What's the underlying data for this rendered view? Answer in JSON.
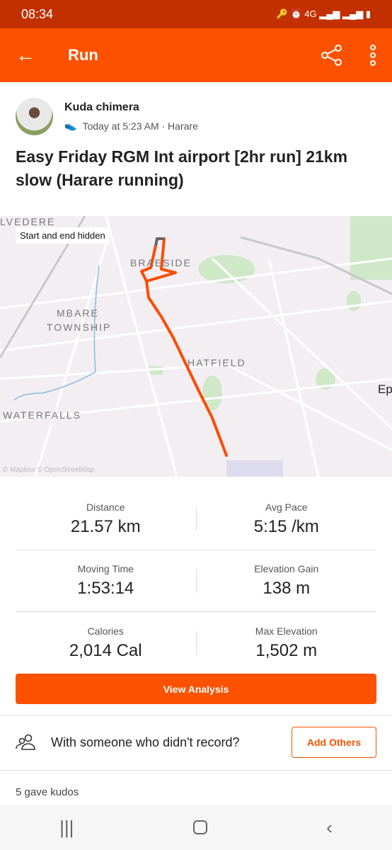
{
  "status_bar": {
    "time": "08:34",
    "network": "4G"
  },
  "app_bar": {
    "title": "Run",
    "back_icon": "arrow-left-icon",
    "share_icon": "share-icon",
    "menu_icon": "more-vertical-icon"
  },
  "athlete": {
    "name": "Kuda chimera",
    "meta": "Today at 5:23 AM · Harare",
    "activity_icon": "shoe-icon"
  },
  "activity_title": "Easy Friday RGM Int airport [2hr run] 21km slow (Harare running)",
  "map": {
    "privacy_label": "Start and end hidden",
    "places": [
      "LVEDERE",
      "BRAESIDE",
      "MBARE",
      "TOWNSHIP",
      "HATFIELD",
      "WATERFALLS",
      "Ep"
    ],
    "attribution": "© Mapbox © OpenStreetMap",
    "route_color": "#fc4c02"
  },
  "stats": [
    [
      {
        "label": "Distance",
        "value": "21.57 km"
      },
      {
        "label": "Avg Pace",
        "value": "5:15 /km"
      }
    ],
    [
      {
        "label": "Moving Time",
        "value": "1:53:14"
      },
      {
        "label": "Elevation Gain",
        "value": "138 m"
      }
    ],
    [
      {
        "label": "Calories",
        "value": "2,014 Cal"
      },
      {
        "label": "Max Elevation",
        "value": "1,502 m"
      }
    ]
  ],
  "view_analysis_label": "View Analysis",
  "with_others": {
    "text": "With someone who didn't record?",
    "button": "Add Others"
  },
  "kudos": "5 gave kudos",
  "accent": "#fc5200"
}
